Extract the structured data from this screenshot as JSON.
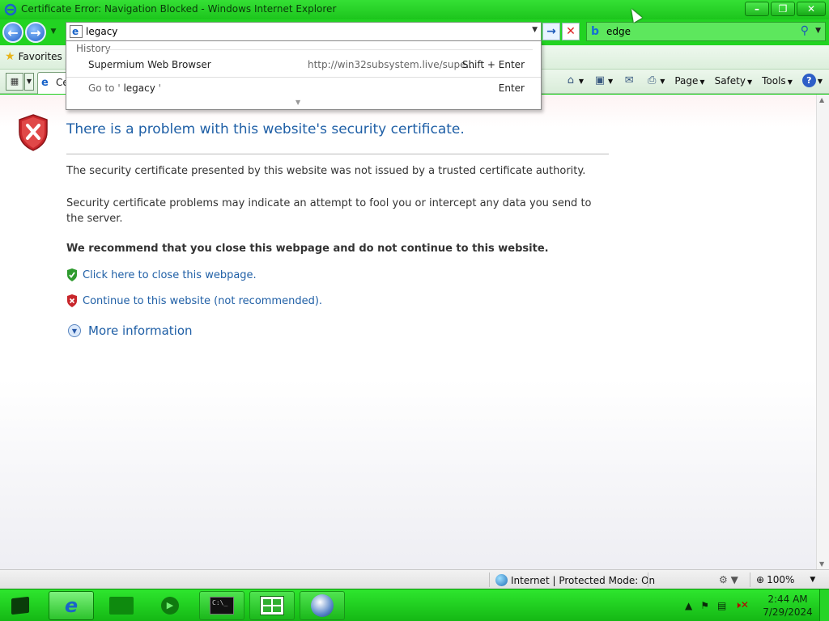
{
  "window": {
    "title": "Certificate Error: Navigation Blocked - Windows Internet Explorer",
    "minimize_label": "–",
    "restore_label": "❐",
    "close_label": "✕"
  },
  "nav": {
    "back_label": "←",
    "forward_label": "→",
    "address_value": "legacy",
    "go_label": "→",
    "stop_label": "✕",
    "search_value": "edge",
    "search_engine_icon": "bing-icon"
  },
  "autocomplete": {
    "header": "History",
    "items": [
      {
        "name": "Supermium Web Browser",
        "url": "http://win32subsystem.live/supe...",
        "shortcut": "Shift + Enter"
      }
    ],
    "goto_prefix": "Go to '",
    "goto_value": " legacy ",
    "goto_suffix": "'",
    "goto_shortcut": "Enter"
  },
  "favorites": {
    "label": "Favorites"
  },
  "tabs": [
    {
      "label": "Ce"
    }
  ],
  "commands": {
    "page": "Page",
    "safety": "Safety",
    "tools": "Tools"
  },
  "content": {
    "title": "There is a problem with this website's security certificate.",
    "p1": "The security certificate presented by this website was not issued by a trusted certificate authority.",
    "p2": "Security certificate problems may indicate an attempt to fool you or intercept any data you send to the server.",
    "recommendation": "We recommend that you close this webpage and do not continue to this website.",
    "close_link": "Click here to close this webpage.",
    "continue_link": "Continue to this website (not recommended).",
    "more_info": "More information"
  },
  "status": {
    "zone": "Internet | Protected Mode: On",
    "zoom": "100%"
  },
  "taskbar": {
    "time": "2:44 AM",
    "date": "7/29/2024"
  },
  "colors": {
    "chrome_green": "#1fcf1f",
    "link_blue": "#1f5fa6",
    "error_red": "#c8262b"
  }
}
